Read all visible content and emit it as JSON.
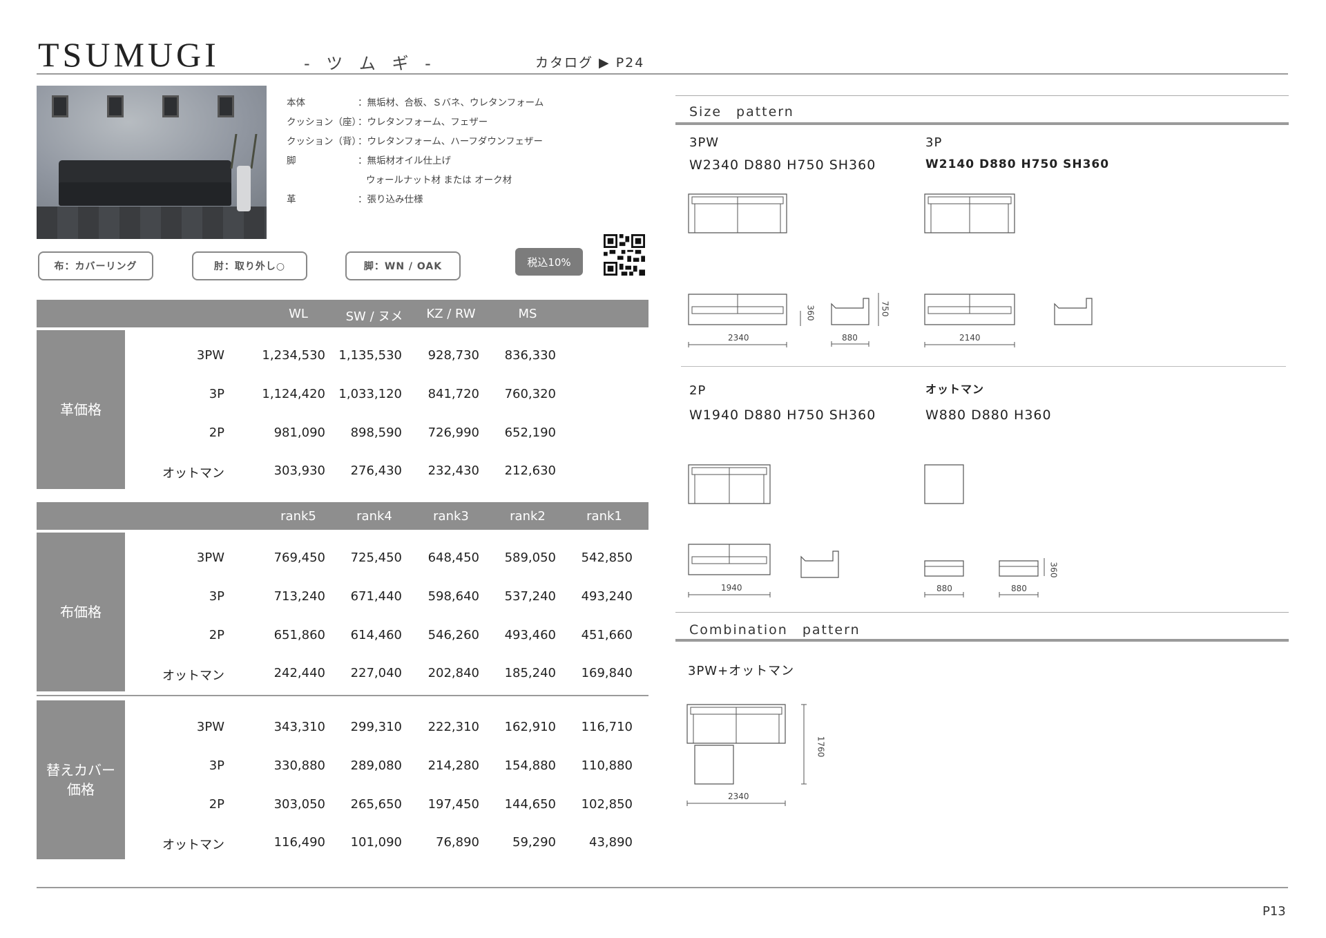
{
  "header": {
    "title": "TSUMUGI",
    "kana": "- ツ ム ギ -",
    "catalog": "カタログ ▶ P24"
  },
  "specs": [
    {
      "label": "本体",
      "value": "：無垢材、合板、Ｓバネ、ウレタンフォーム"
    },
    {
      "label": "クッション（座）",
      "value": "：ウレタンフォーム、フェザー"
    },
    {
      "label": "クッション（背）",
      "value": "：ウレタンフォーム、ハーフダウンフェザー"
    },
    {
      "label": "脚",
      "value": "：無垢材オイル仕上げ"
    },
    {
      "label": "",
      "value": "ウォールナット材 または オーク材"
    },
    {
      "label": "革",
      "value": "：張り込み仕様"
    }
  ],
  "tags": [
    "布：カバーリング",
    "肘：取り外し○",
    "脚：WN / OAK"
  ],
  "tax_badge": "税込10%",
  "leather": {
    "headers": [
      "WL",
      "SW / ヌメ",
      "KZ / RW",
      "MS"
    ],
    "side_label": "革価格",
    "rows": [
      {
        "name": "3PW",
        "values": [
          "1,234,530",
          "1,135,530",
          "928,730",
          "836,330"
        ]
      },
      {
        "name": "3P",
        "values": [
          "1,124,420",
          "1,033,120",
          "841,720",
          "760,320"
        ]
      },
      {
        "name": "2P",
        "values": [
          "981,090",
          "898,590",
          "726,990",
          "652,190"
        ]
      },
      {
        "name": "オットマン",
        "values": [
          "303,930",
          "276,430",
          "232,430",
          "212,630"
        ]
      }
    ]
  },
  "fabric": {
    "headers": [
      "rank5",
      "rank4",
      "rank3",
      "rank2",
      "rank1"
    ],
    "side_label": "布価格",
    "rows": [
      {
        "name": "3PW",
        "values": [
          "769,450",
          "725,450",
          "648,450",
          "589,050",
          "542,850"
        ]
      },
      {
        "name": "3P",
        "values": [
          "713,240",
          "671,440",
          "598,640",
          "537,240",
          "493,240"
        ]
      },
      {
        "name": "2P",
        "values": [
          "651,860",
          "614,460",
          "546,260",
          "493,460",
          "451,660"
        ]
      },
      {
        "name": "オットマン",
        "values": [
          "242,440",
          "227,040",
          "202,840",
          "185,240",
          "169,840"
        ]
      }
    ]
  },
  "cover": {
    "side_label_1": "替えカバー",
    "side_label_2": "価格",
    "rows": [
      {
        "name": "3PW",
        "values": [
          "343,310",
          "299,310",
          "222,310",
          "162,910",
          "116,710"
        ]
      },
      {
        "name": "3P",
        "values": [
          "330,880",
          "289,080",
          "214,280",
          "154,880",
          "110,880"
        ]
      },
      {
        "name": "2P",
        "values": [
          "303,050",
          "265,650",
          "197,450",
          "144,650",
          "102,850"
        ]
      },
      {
        "name": "オットマン",
        "values": [
          "116,490",
          "101,090",
          "76,890",
          "59,290",
          "43,890"
        ]
      }
    ]
  },
  "size_pattern": {
    "title": "Size　pattern",
    "items": [
      {
        "name": "3PW",
        "dims": "W2340 D880 H750 SH360",
        "width_label": "2340",
        "depth_label": "880",
        "sh_label": "360",
        "h_label": "750"
      },
      {
        "name": "3P",
        "dims": "W2140 D880 H750 SH360",
        "width_label": "2140"
      },
      {
        "name": "2P",
        "dims": "W1940 D880 H750 SH360",
        "width_label": "1940"
      },
      {
        "name": "オットマン",
        "dims": "W880 D880 H360",
        "width_label_1": "880",
        "width_label_2": "880",
        "h_label": "360"
      }
    ]
  },
  "combination_pattern": {
    "title": "Combination　pattern",
    "name": "3PW+オットマン",
    "width_label": "2340",
    "depth_label": "1760"
  },
  "footer": {
    "page": "P13"
  }
}
